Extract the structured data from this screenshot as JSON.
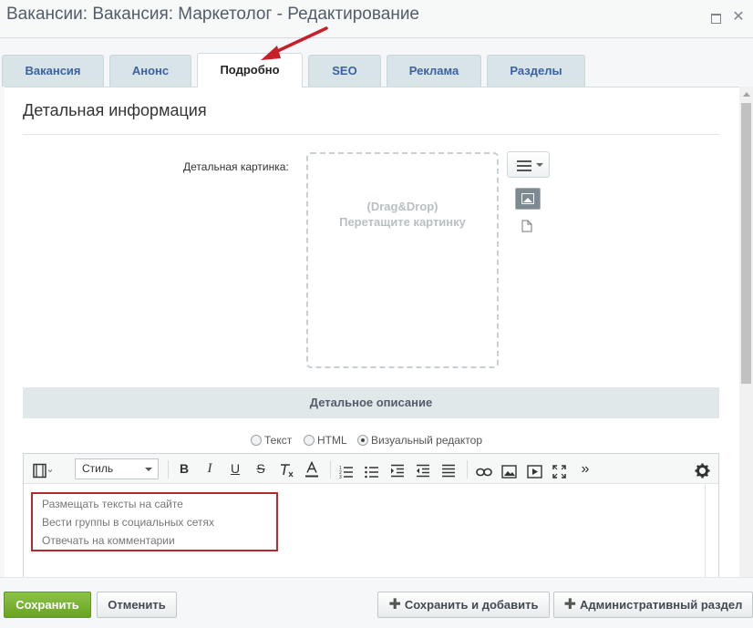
{
  "window": {
    "title": "Вакансии: Вакансия: Маркетолог - Редактирование",
    "maximize_icon": "maximize-icon",
    "close_icon": "close-icon",
    "close_glyph": "✕"
  },
  "tabs": [
    {
      "label": "Вакансия",
      "active": false
    },
    {
      "label": "Анонс",
      "active": false
    },
    {
      "label": "Подробно",
      "active": true
    },
    {
      "label": "SEO",
      "active": false
    },
    {
      "label": "Реклама",
      "active": false
    },
    {
      "label": "Разделы",
      "active": false
    }
  ],
  "section": {
    "title": "Детальная информация",
    "picture_label": "Детальная картинка:",
    "dropzone_line1": "(Drag&Drop)",
    "dropzone_line2": "Перетащите картинку"
  },
  "description": {
    "header": "Детальное описание",
    "modes": [
      {
        "label": "Текст",
        "checked": false
      },
      {
        "label": "HTML",
        "checked": false
      },
      {
        "label": "Визуальный редактор",
        "checked": true
      }
    ]
  },
  "editor": {
    "style_select": "Стиль",
    "toolbar": {
      "bold": "B",
      "italic": "I",
      "underline": "U",
      "strike": "S",
      "more": "»"
    },
    "content": [
      "Размещать тексты на сайте",
      "Вести группы в социальных сетях",
      "Отвечать на комментарии"
    ]
  },
  "footer": {
    "save": "Сохранить",
    "cancel": "Отменить",
    "save_add": "Сохранить и добавить",
    "admin": "Административный раздел"
  },
  "colors": {
    "accent_green": "#6aa321",
    "tab_text": "#3b62a0",
    "highlight_red": "#b5282e"
  }
}
